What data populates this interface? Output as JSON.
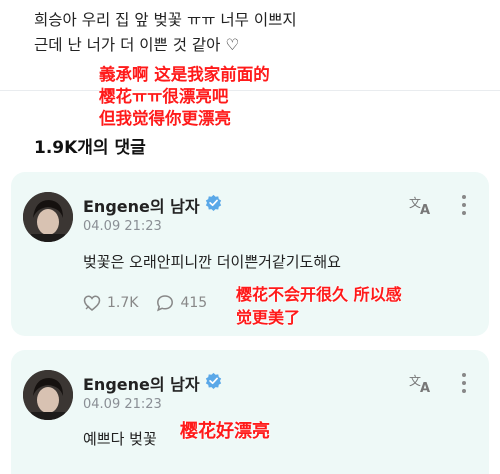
{
  "post": {
    "line1": "희승아 우리 집 앞 벚꽃 ㅠㅠ 너무 이쁘지",
    "line2": "근데 난 너가 더 이쁜 것 같아 ♡"
  },
  "overlays": {
    "post_translation": [
      "義承啊 这是我家前面的",
      "樱花ㅠㅠ很漂亮吧",
      "但我觉得你更漂亮"
    ],
    "comment1_translation": [
      "樱花不会开很久 所以感",
      "觉更美了"
    ],
    "comment2_translation": "樱花好漂亮"
  },
  "comment_count": "1.9K개의 댓글",
  "comments": [
    {
      "username": "Engene의 남자",
      "timestamp": "04.09 21:23",
      "text": "벚꽃은 오래안피니깐 더이쁜거같기도해요",
      "likes": "1.7K",
      "replies": "415"
    },
    {
      "username": "Engene의 남자",
      "timestamp": "04.09 21:23",
      "text": "예쁘다 벚꽃"
    }
  ],
  "colors": {
    "card_bg": "#eef9f7",
    "overlay_red": "#ff1a1a",
    "verified": "#5aa8e8",
    "muted": "#8a8f95"
  },
  "icons": [
    "verified-badge-icon",
    "translate-icon",
    "more-options-icon",
    "like-icon",
    "reply-icon"
  ]
}
